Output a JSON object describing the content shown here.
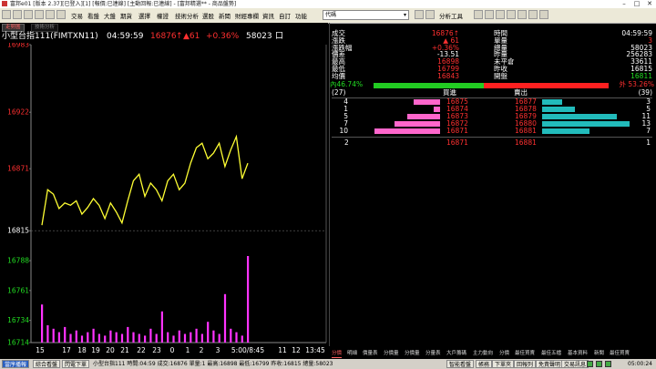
{
  "window": {
    "title": "富邦e01 [版本 2.37][已登入][1] [報價:已連線] [主動回報:已連線] - [富邦精選** - 商品盤勢]"
  },
  "menu": {
    "items": [
      "交易",
      "看盤",
      "大盤",
      "期貨",
      "選擇",
      "權證",
      "技術分析",
      "選股",
      "新聞",
      "財經專欄",
      "資訊",
      "自訂",
      "功能"
    ],
    "combo_value": "代碼",
    "analysis_tools": "分析工具"
  },
  "chart_tabs": {
    "active": "走勢圖",
    "other": "技術分析"
  },
  "chart_header": {
    "symbol": "小型台指111(FIMTXN11)",
    "time": "04:59:59",
    "price": "16876",
    "change": "▲61",
    "pct": "+0.36%",
    "volume": "58023"
  },
  "chart_data": {
    "type": "line",
    "title": "",
    "ylabel": "",
    "xlabel": "",
    "ylim": [
      16714,
      16983
    ],
    "y_ticks": [
      16983,
      16922,
      16871,
      16815,
      16788,
      16761,
      16734,
      16714
    ],
    "x_ticks": [
      "15",
      "17",
      "18",
      "19",
      "20",
      "21",
      "22",
      "23",
      "0",
      "1",
      "2",
      "3",
      "5:00/8:45",
      "11",
      "12",
      "13:45"
    ],
    "reference_price": 16815,
    "series": [
      {
        "values": [
          16820,
          16852,
          16848,
          16835,
          16840,
          16838,
          16842,
          16830,
          16836,
          16844,
          16838,
          16826,
          16840,
          16832,
          16822,
          16842,
          16860,
          16866,
          16846,
          16858,
          16852,
          16842,
          16860,
          16866,
          16852,
          16858,
          16876,
          16890,
          16894,
          16880,
          16885,
          16894,
          16873,
          16888,
          16900,
          16862,
          16876
        ]
      }
    ],
    "volume_values": [
      22,
      10,
      8,
      6,
      9,
      5,
      7,
      4,
      6,
      8,
      5,
      4,
      7,
      6,
      5,
      9,
      6,
      5,
      4,
      8,
      5,
      18,
      6,
      4,
      7,
      5,
      6,
      8,
      5,
      12,
      7,
      5,
      28,
      8,
      6,
      4,
      50
    ]
  },
  "quote": {
    "left_rows": [
      {
        "label": "成交",
        "value": "16876",
        "arrow": "↑",
        "color": "#ff3030"
      },
      {
        "label": "漲跌",
        "value": "61",
        "arrow": "▲",
        "color": "#ff3030"
      },
      {
        "label": "漲跌幅",
        "value": "+0.36%",
        "arrow": "",
        "color": "#ff3030"
      },
      {
        "label": "價差",
        "value": "-13.51",
        "arrow": "",
        "color": "#ffffff"
      },
      {
        "label": "最高",
        "value": "16898",
        "arrow": "",
        "color": "#ff3030"
      },
      {
        "label": "最低",
        "value": "16799",
        "arrow": "",
        "color": "#ff3030"
      },
      {
        "label": "均價",
        "value": "16843",
        "arrow": "",
        "color": "#ff3030"
      }
    ],
    "right_rows": [
      {
        "label": "時間",
        "value": "04:59:59",
        "color": "#ffffff"
      },
      {
        "label": "單量",
        "value": "3",
        "color": "#ff3030"
      },
      {
        "label": "總量",
        "value": "58023",
        "color": "#ffffff"
      },
      {
        "label": "昨量",
        "value": "256283",
        "color": "#ffffff"
      },
      {
        "label": "未平倉",
        "value": "33611",
        "color": "#ffffff"
      },
      {
        "label": "昨收",
        "value": "16815",
        "color": "#ffffff"
      },
      {
        "label": "開盤",
        "value": "16811",
        "color": "#22dd22"
      }
    ],
    "inner_label": "內",
    "inner_pct": "46.74%",
    "inner_fraction": 0.4674,
    "outer_label": "外",
    "outer_pct": "53.26%",
    "book_head": {
      "left_count": "(27)",
      "buy_label": "買進",
      "sell_label": "賣出",
      "right_count": "(39)"
    },
    "bids": [
      {
        "qty": "4",
        "price": "16875",
        "level": 0.4
      },
      {
        "qty": "1",
        "price": "16874",
        "level": 0.1
      },
      {
        "qty": "5",
        "price": "16873",
        "level": 0.5
      },
      {
        "qty": "7",
        "price": "16872",
        "level": 0.7
      },
      {
        "qty": "10",
        "price": "16871",
        "level": 1.0
      }
    ],
    "asks": [
      {
        "price": "16877",
        "qty": "3",
        "level": 0.23
      },
      {
        "price": "16878",
        "qty": "5",
        "level": 0.38
      },
      {
        "price": "16879",
        "qty": "11",
        "level": 0.85
      },
      {
        "price": "16880",
        "qty": "13",
        "level": 1.0
      },
      {
        "price": "16881",
        "qty": "7",
        "level": 0.54
      }
    ],
    "summary": {
      "left_qty": "2",
      "bid_price": "16871",
      "ask_price": "16881",
      "right_qty": "1"
    }
  },
  "bottom_tabs": [
    "分價",
    "明細",
    "價量表",
    "分價量",
    "分價量",
    "分量表",
    "大戶籌碼",
    "主力動向",
    "分價",
    "最佳買賣",
    "最佳五檔",
    "基本資料",
    "新聞",
    "最佳買賣"
  ],
  "status": {
    "btn1": "當序播報",
    "btn2": "綜合看盤",
    "btn3": "閃電下單",
    "ticker": "小型台指111 時間:04:59 成交:16876 單量:1 最高:16898 最低:16799 昨收:16815 總量:58023",
    "btn4": "智能看盤",
    "btn5": "帳務",
    "btn6": "下單夾",
    "btn7": "回報列",
    "btn8": "免責聲明",
    "btn9": "交易訊息",
    "clock": "05:00:24"
  }
}
